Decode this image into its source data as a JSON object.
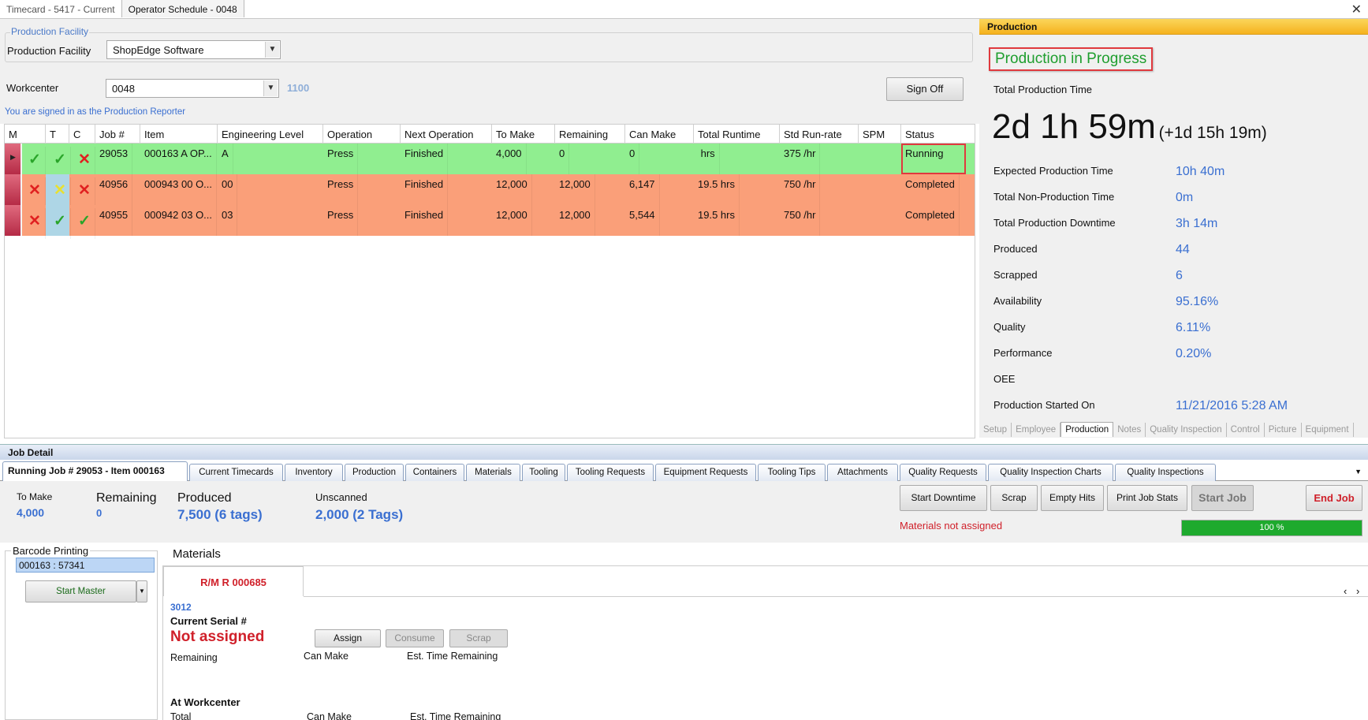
{
  "doc_tabs": [
    "Timecard - 5417 - Current",
    "Operator Schedule - 0048"
  ],
  "facility": {
    "legend": "Production Facility",
    "label": "Production Facility",
    "value": "ShopEdge Software"
  },
  "workcenter": {
    "label": "Workcenter",
    "value": "0048",
    "extra": "1100"
  },
  "signed_in": "You are signed in as the Production Reporter",
  "sign_off": "Sign Off",
  "grid": {
    "headers": [
      "M",
      "T",
      "C",
      "Job #",
      "Item",
      "Engineering Level",
      "Operation",
      "Next Operation",
      "To Make",
      "Remaining",
      "Can Make",
      "Total Runtime",
      "Std Run-rate",
      "SPM",
      "Status"
    ],
    "rows": [
      {
        "job": "29053",
        "item": "000163  A  OP...",
        "eng": "A",
        "op": "Press",
        "next": "Finished",
        "tomake": "4,000",
        "remaining": "0",
        "canmake": "0",
        "runtime": " hrs",
        "rate": "375 /hr",
        "spm": "",
        "status": "Running",
        "t": "check",
        "c": "x",
        "tc": "check"
      },
      {
        "job": "40956",
        "item": "000943  00  O...",
        "eng": "00",
        "op": "Press",
        "next": "Finished",
        "tomake": "12,000",
        "remaining": "12,000",
        "canmake": "6,147",
        "runtime": "19.5 hrs",
        "rate": "750 /hr",
        "spm": "",
        "status": "Completed"
      },
      {
        "job": "40955",
        "item": "000942  03  O...",
        "eng": "03",
        "op": "Press",
        "next": "Finished",
        "tomake": "12,000",
        "remaining": "12,000",
        "canmake": "5,544",
        "runtime": "19.5 hrs",
        "rate": "750 /hr",
        "spm": "",
        "status": "Completed"
      }
    ]
  },
  "production": {
    "header": "Production",
    "title": "Production in Progress",
    "total_label": "Total Production Time",
    "total_big": "2d 1h 59m",
    "total_extra": "(+1d 15h 19m)",
    "stats": [
      {
        "label": "Expected Production Time",
        "value": "10h 40m"
      },
      {
        "label": "Total Non-Production Time",
        "value": "0m"
      },
      {
        "label": "Total Production Downtime",
        "value": "3h 14m"
      },
      {
        "label": "Produced",
        "value": "44"
      },
      {
        "label": "Scrapped",
        "value": "6"
      },
      {
        "label": "Availability",
        "value": "95.16%"
      },
      {
        "label": "Quality",
        "value": "6.11%"
      },
      {
        "label": "Performance",
        "value": "0.20%"
      },
      {
        "label": "OEE",
        "value": ""
      },
      {
        "label": "Production Started On",
        "value": "11/21/2016 5:28 AM"
      }
    ],
    "tabs": [
      "Setup",
      "Employee",
      "Production",
      "Notes",
      "Quality Inspection",
      "Control",
      "Picture",
      "Equipment"
    ]
  },
  "job_detail": {
    "header": "Job Detail",
    "tabs": [
      "Running Job # 29053 - Item 000163",
      "Current Timecards",
      "Inventory",
      "Production",
      "Containers",
      "Materials",
      "Tooling",
      "Tooling Requests",
      "Equipment Requests",
      "Tooling Tips",
      "Attachments",
      "Quality Requests",
      "Quality Inspection Charts",
      "Quality Inspections"
    ],
    "to_make_label": "To Make",
    "to_make": "4,000",
    "remaining_label": "Remaining",
    "remaining": "0",
    "produced_label": "Produced",
    "produced": "7,500 (6 tags)",
    "unscanned_label": "Unscanned",
    "unscanned": "2,000 (2 Tags)",
    "buttons": [
      "Start Downtime",
      "Scrap",
      "Empty Hits",
      "Print Job Stats",
      "Start Job",
      "End Job"
    ],
    "materials_warning": "Materials not assigned",
    "progress": {
      "value": 1.0,
      "label": "100 %"
    },
    "barcode": {
      "title": "Barcode Printing",
      "item": "000163 : 57341",
      "start_master": "Start Master"
    },
    "materials": {
      "title": "Materials",
      "tab": "R/M R 000685",
      "code": "3012",
      "serial_label": "Current Serial #",
      "serial_value": "Not assigned",
      "assign": "Assign",
      "consume": "Consume",
      "scrap": "Scrap",
      "remaining": "Remaining",
      "can_make": "Can Make",
      "est_time": "Est. Time Remaining",
      "at_wc": "At Workcenter",
      "total": "Total",
      "can_make2": "Can Make",
      "est_time2": "Est. Time Remaining"
    }
  },
  "colors": {
    "running": "#90ee90",
    "completed": "#fa9f79",
    "accent": "#3a6fd1",
    "highlight": "#e0393e"
  }
}
